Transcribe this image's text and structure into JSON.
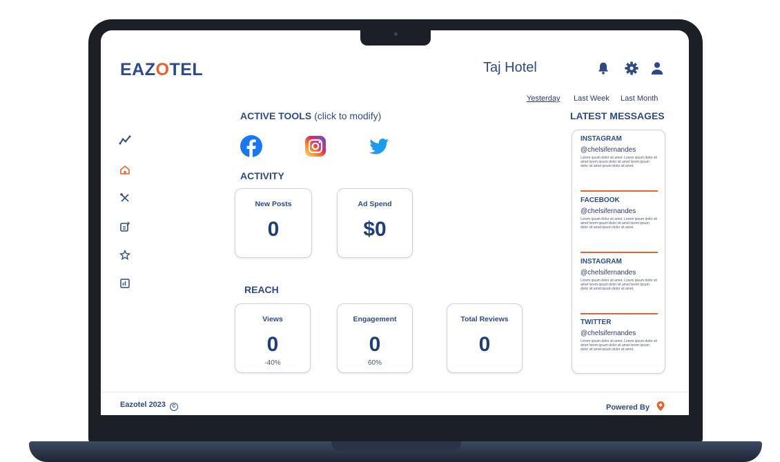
{
  "header": {
    "logo_pre": "EAZ",
    "logo_o": "O",
    "logo_post": "TEL",
    "hotel_name": "Taj Hotel",
    "icons": [
      "bell-icon",
      "gear-icon",
      "user-icon"
    ]
  },
  "periods": [
    "Yesterday",
    "Last Week",
    "Last Month"
  ],
  "sidebar": {
    "icons": [
      "trend-icon",
      "home-icon",
      "tools-icon",
      "compose-icon",
      "star-icon",
      "report-icon"
    ]
  },
  "tools": {
    "title": "ACTIVE TOOLS",
    "hint": "(click to modify)",
    "items": [
      "facebook-icon",
      "instagram-icon",
      "twitter-icon"
    ]
  },
  "activity": {
    "title": "ACTIVITY",
    "cards": [
      {
        "label": "New Posts",
        "value": "0"
      },
      {
        "label": "Ad Spend",
        "value": "$0"
      }
    ]
  },
  "reach": {
    "title": "REACH",
    "cards": [
      {
        "label": "Views",
        "value": "0",
        "change": "-40%"
      },
      {
        "label": "Engagement",
        "value": "0",
        "change": "60%"
      },
      {
        "label": "Total Reviews",
        "value": "0",
        "change": ""
      }
    ]
  },
  "messages": {
    "title": "LATEST MESSAGES",
    "items": [
      {
        "source": "INSTAGRAM",
        "user": "@chelsifernandes",
        "body": "Lorem ipsum dolor sit amet. Lorem ipsum dolor sit amet lorem ipsum dolor sit amet lorem ipsum dolor sit amet ipsum dolor sit amet."
      },
      {
        "source": "FACEBOOK",
        "user": "@chelsifernandes",
        "body": "Lorem ipsum dolor sit amet. Lorem ipsum dolor sit amet lorem ipsum dolor sit amet lorem ipsum dolor sit amet ipsum dolor sit amet."
      },
      {
        "source": "INSTAGRAM",
        "user": "@chelsifernandes",
        "body": "Lorem ipsum dolor sit amet. Lorem ipsum dolor sit amet lorem ipsum dolor sit amet lorem ipsum dolor sit amet ipsum dolor sit amet."
      },
      {
        "source": "TWITTER",
        "user": "@chelsifernandes",
        "body": "Lorem ipsum dolor sit amet. Lorem ipsum dolor sit amet lorem ipsum dolor sit amet lorem ipsum dolor sit amet ipsum dolor sit amet."
      }
    ]
  },
  "footer": {
    "left": "Eazotel 2023",
    "right": "Powered By"
  },
  "colors": {
    "brand_blue": "#2c4a8a",
    "accent_orange": "#e8632b",
    "facebook": "#1877f2",
    "twitter": "#1d9bf0"
  }
}
